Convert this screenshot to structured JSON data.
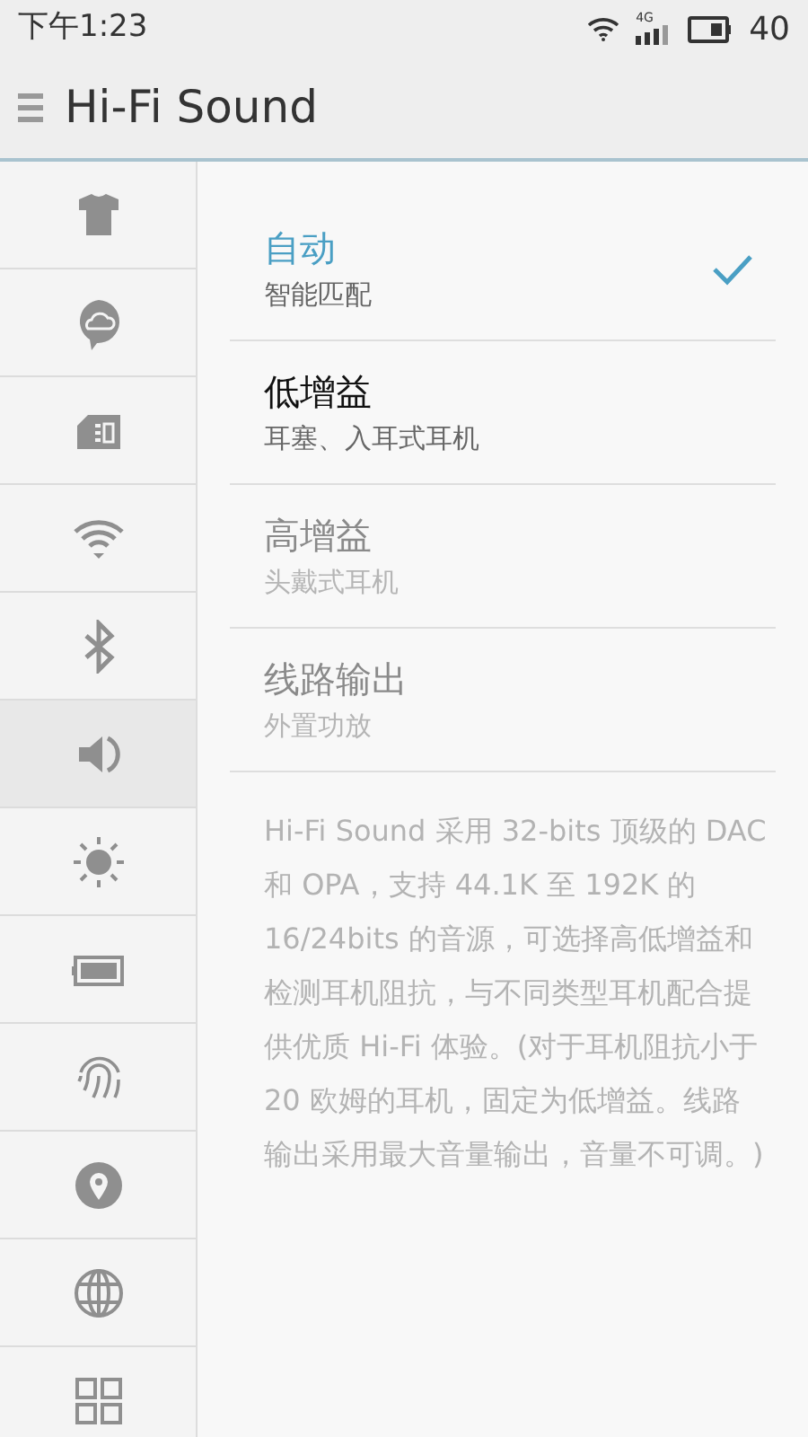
{
  "status_bar": {
    "time": "下午1:23",
    "network": "4G",
    "battery": "40"
  },
  "header": {
    "title": "Hi-Fi Sound"
  },
  "sidebar": {
    "items": [
      {
        "selected": false
      },
      {
        "selected": false
      },
      {
        "selected": false
      },
      {
        "selected": false
      },
      {
        "selected": false
      },
      {
        "selected": true
      },
      {
        "selected": false
      },
      {
        "selected": false
      },
      {
        "selected": false
      },
      {
        "selected": false
      },
      {
        "selected": false
      },
      {
        "selected": false
      }
    ]
  },
  "options": [
    {
      "title": "自动",
      "subtitle": "智能匹配",
      "selected": true,
      "disabled": false
    },
    {
      "title": "低增益",
      "subtitle": "耳塞、入耳式耳机",
      "selected": false,
      "disabled": false
    },
    {
      "title": "高增益",
      "subtitle": "头戴式耳机",
      "selected": false,
      "disabled": true
    },
    {
      "title": "线路输出",
      "subtitle": "外置功放",
      "selected": false,
      "disabled": true
    }
  ],
  "description": "Hi-Fi Sound 采用 32-bits 顶级的 DAC 和 OPA，支持 44.1K 至 192K 的 16/24bits 的音源，可选择高低增益和检测耳机阻抗，与不同类型耳机配合提供优质 Hi-Fi 体验。(对于耳机阻抗小于 20 欧姆的耳机，固定为低增益。线路输出采用最大音量输出，音量不可调。)"
}
